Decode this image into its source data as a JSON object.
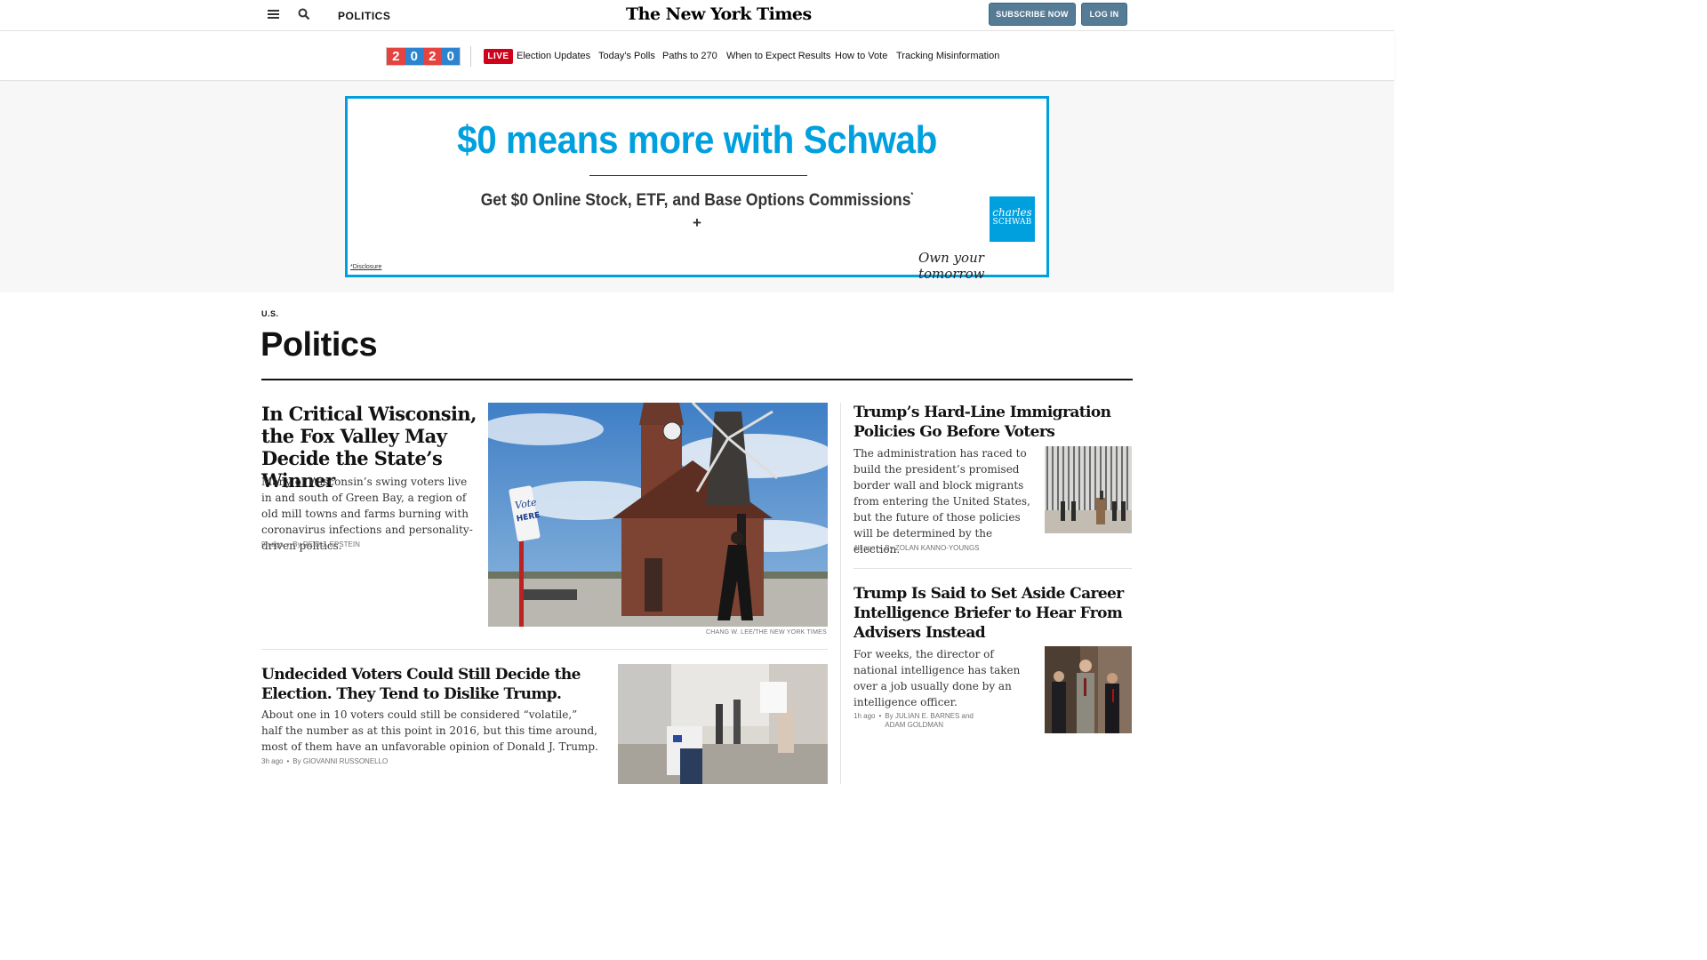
{
  "masthead": {
    "section": "POLITICS",
    "logo": "The New York Times",
    "subscribe_label": "SUBSCRIBE NOW",
    "login_label": "LOG IN"
  },
  "election_nav": {
    "year_digits": [
      "2",
      "0",
      "2",
      "0"
    ],
    "live_label": "LIVE",
    "links": [
      "Election Updates",
      "Today's Polls",
      "Paths to 270",
      "When to Expect Results",
      "How to Vote",
      "Tracking Misinformation"
    ]
  },
  "ad": {
    "headline": "$0 means more with Schwab",
    "subline": "Get $0 Online Stock, ETF, and Base Options Commissions",
    "subline_mark": "*",
    "plus": "+",
    "logo_line1": "charles",
    "logo_line2": "SCHWAB",
    "tagline": "Own your tomorrow",
    "disclosure": "*Disclosure",
    "brand_color": "#00a0df"
  },
  "section_header": {
    "kicker": "U.S.",
    "title": "Politics"
  },
  "stories": [
    {
      "headline": "In Critical Wisconsin, the Fox Valley May Decide the State’s Winner",
      "summary": "Many of Wisconsin’s swing voters live in and south of Green Bay, a region of old mill towns and farms burning with coronavirus infections and personality-driven politics.",
      "time": "9h ago",
      "byline": "By REID J. EPSTEIN",
      "credit": "CHANG W. LEE/THE NEW YORK TIMES"
    },
    {
      "headline": "Undecided Voters Could Still Decide the Election. They Tend to Dislike Trump.",
      "summary": "About one in 10 voters could still be considered “volatile,” half the number as at this point in 2016, but this time around, most of them have an unfavorable opinion of Donald J. Trump.",
      "time": "3h ago",
      "byline": "By GIOVANNI RUSSONELLO"
    },
    {
      "headline": "Trump’s Hard-Line Immigration Policies Go Before Voters",
      "summary": "The administration has raced to build the president’s promised border wall and block migrants from entering the United States, but the future of those policies will be determined by the election.",
      "time": "4h ago",
      "byline": "By ZOLAN KANNO-YOUNGS"
    },
    {
      "headline": "Trump Is Said to Set Aside Career Intelligence Briefer to Hear From Advisers Instead",
      "summary": "For weeks, the director of national intelligence has taken over a job usually done by an intelligence officer.",
      "time": "1h ago",
      "byline": "By JULIAN E. BARNES and ADAM GOLDMAN"
    }
  ],
  "photo_text": {
    "vote_sign_line1": "Vote",
    "vote_sign_line2": "HERE"
  }
}
